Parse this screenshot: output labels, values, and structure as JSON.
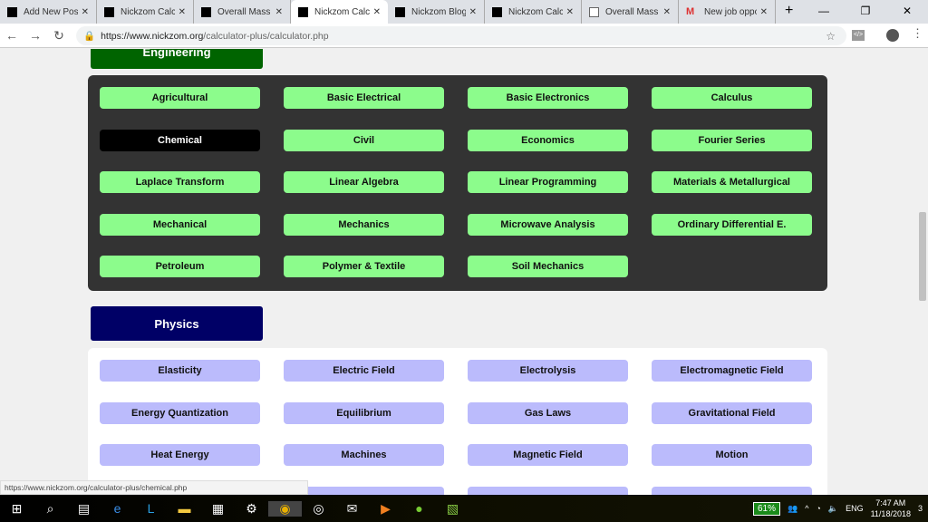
{
  "browser": {
    "tabs": [
      {
        "title": "Add New Post",
        "icon": "nickzom-icon"
      },
      {
        "title": "Nickzom Calcu",
        "icon": "nickzom-icon"
      },
      {
        "title": "Overall Mass T",
        "icon": "nickzom-icon"
      },
      {
        "title": "Nickzom Calcu",
        "icon": "nickzom-icon",
        "active": true
      },
      {
        "title": "Nickzom Blog",
        "icon": "nickzom-icon"
      },
      {
        "title": "Nickzom Calcu",
        "icon": "nickzom-icon"
      },
      {
        "title": "Overall Mass T",
        "icon": "document-icon"
      },
      {
        "title": "New job oppo",
        "icon": "gmail-icon"
      }
    ],
    "url_host": "https://www.nickzom.org",
    "url_path": "/calculator-plus/calculator.php",
    "status_url": "https://www.nickzom.org/calculator-plus/chemical.php"
  },
  "engineering": {
    "title": "Engineering",
    "color": "#006400",
    "items": [
      "Agricultural",
      "Basic Electrical",
      "Basic Electronics",
      "Calculus",
      "Chemical",
      "Civil",
      "Economics",
      "Fourier Series",
      "Laplace Transform",
      "Linear Algebra",
      "Linear Programming",
      "Materials & Metallurgical",
      "Mechanical",
      "Mechanics",
      "Microwave Analysis",
      "Ordinary Differential E.",
      "Petroleum",
      "Polymer & Textile",
      "Soil Mechanics"
    ],
    "selected": "Chemical"
  },
  "physics": {
    "title": "Physics",
    "color": "#000066",
    "items": [
      "Elasticity",
      "Electric Field",
      "Electrolysis",
      "Electromagnetic Field",
      "Energy Quantization",
      "Equilibrium",
      "Gas Laws",
      "Gravitational Field",
      "Heat Energy",
      "Machines",
      "Magnetic Field",
      "Motion",
      "",
      "",
      "",
      ""
    ]
  },
  "taskbar": {
    "battery": "61%",
    "lang": "ENG",
    "time": "7:47 AM",
    "date": "11/18/2018",
    "notifications": "3"
  }
}
